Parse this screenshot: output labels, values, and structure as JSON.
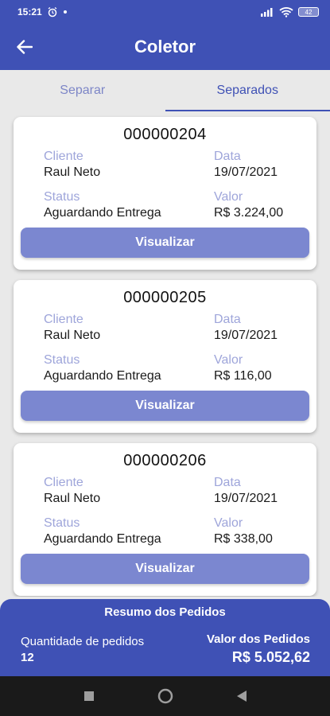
{
  "status_bar": {
    "time": "15:21",
    "battery": "42"
  },
  "app_bar": {
    "title": "Coletor"
  },
  "tabs": [
    {
      "label": "Separar",
      "active": false
    },
    {
      "label": "Separados",
      "active": true
    }
  ],
  "orders": [
    {
      "number": "000000204",
      "client_label": "Cliente",
      "client": "Raul Neto",
      "date_label": "Data",
      "date": "19/07/2021",
      "status_label": "Status",
      "status": "Aguardando Entrega",
      "value_label": "Valor",
      "value": "R$ 3.224,00",
      "button": "Visualizar"
    },
    {
      "number": "000000205",
      "client_label": "Cliente",
      "client": "Raul Neto",
      "date_label": "Data",
      "date": "19/07/2021",
      "status_label": "Status",
      "status": "Aguardando Entrega",
      "value_label": "Valor",
      "value": "R$ 116,00",
      "button": "Visualizar"
    },
    {
      "number": "000000206",
      "client_label": "Cliente",
      "client": "Raul Neto",
      "date_label": "Data",
      "date": "19/07/2021",
      "status_label": "Status",
      "status": "Aguardando Entrega",
      "value_label": "Valor",
      "value": "R$ 338,00",
      "button": "Visualizar"
    }
  ],
  "summary": {
    "title": "Resumo dos Pedidos",
    "quantity_label": "Quantidade de pedidos",
    "quantity": "12",
    "total_label": "Valor dos Pedidos",
    "total": "R$ 5.052,62"
  },
  "colors": {
    "primary": "#3f51b5",
    "button": "#7b87d0",
    "label": "#9ea5da"
  }
}
